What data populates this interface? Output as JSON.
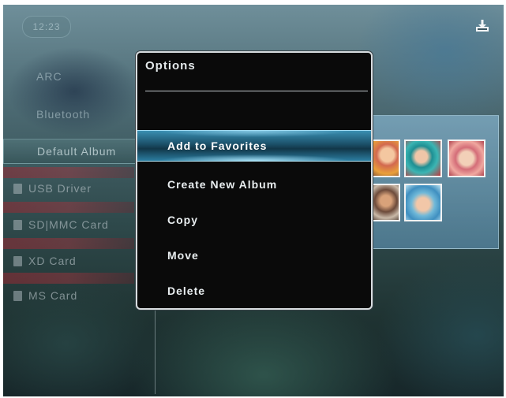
{
  "top_bar": {
    "date_text": "12:23",
    "download_icon": "download-icon"
  },
  "left_menu": {
    "items": [
      {
        "label": "ARC"
      },
      {
        "label": "Bluetooth"
      },
      {
        "label": "Default Album"
      }
    ],
    "storage": [
      {
        "label": "USB Driver",
        "icon": "usb-drive-icon"
      },
      {
        "label": "SD|MMC Card",
        "icon": "card-icon"
      },
      {
        "label": "XD Card",
        "icon": "card-icon"
      },
      {
        "label": "MS Card",
        "icon": "card-icon"
      }
    ]
  },
  "options_dialog": {
    "title": "Options",
    "items": [
      {
        "label": "Add to Favorites",
        "selected": true
      },
      {
        "label": "Create New Album"
      },
      {
        "label": "Copy"
      },
      {
        "label": "Move"
      },
      {
        "label": "Delete"
      }
    ]
  },
  "colors": {
    "highlight": "#2b7da0",
    "dialog_bg": "#0a0a0a",
    "dialog_border": "#d8dde0"
  }
}
